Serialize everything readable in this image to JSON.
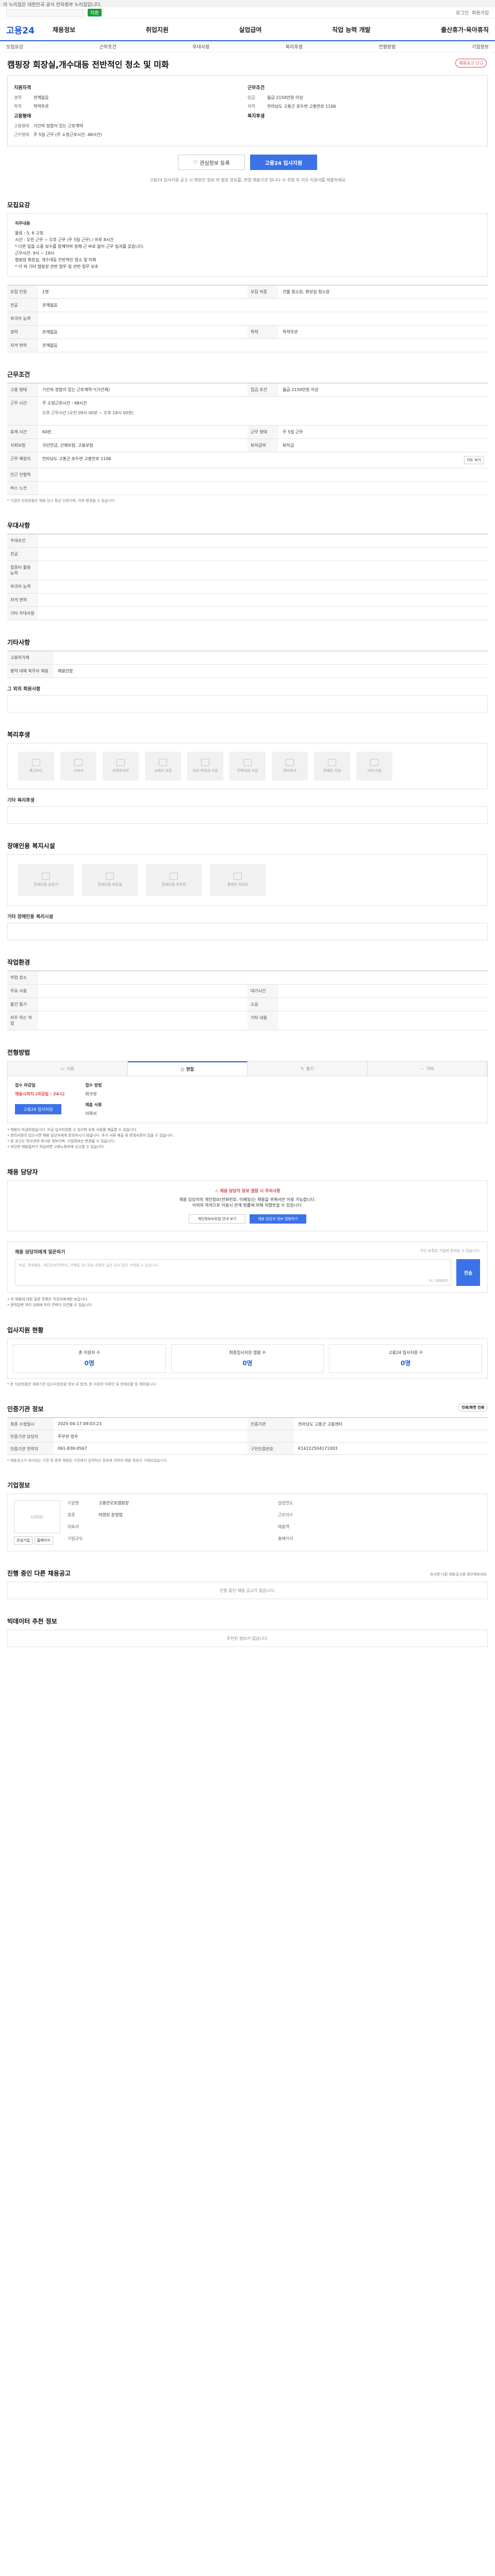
{
  "topbar": {
    "text": "이 누리집은 대한민국 공식 전자정부 누리집입니다."
  },
  "gov_banner": {
    "badge": "지원",
    "util_links": [
      "로그인",
      "회원가입"
    ]
  },
  "header": {
    "logo": "고용24",
    "nav": [
      "채용정보",
      "취업지원",
      "실업급여",
      "직업 능력 개발",
      "출산휴가·육아휴직"
    ]
  },
  "sub_tabs": [
    "모집요강",
    "근무조건",
    "우대사항",
    "복리후생",
    "전형방법",
    "기업정보"
  ],
  "page": {
    "title": "캠핑장 회장실,개수대등 전반적인 청소 및 미화",
    "report_label": "채용공고 신고"
  },
  "summary": {
    "left_heading_1": "지원자격",
    "left_items": [
      {
        "k": "경력",
        "v": "관계없음"
      },
      {
        "k": "학력",
        "v": "학력무관"
      }
    ],
    "left_heading_2": "고용형태",
    "left_items_2": [
      {
        "k": "고용형태",
        "v": "기간의 정함이 있는 근로계약"
      },
      {
        "k": "근무형태",
        "v": "주 5일 근무 (주 소정근로시간: 48시간)"
      }
    ],
    "right_heading_1": "근무조건",
    "right_items": [
      {
        "k": "임금",
        "v": "월급 2150만원 이상"
      },
      {
        "k": "지역",
        "v": "전라남도 고흥군 포두면 고흥만로 1106"
      }
    ],
    "right_heading_2": "복지후생"
  },
  "actions": {
    "bookmark": "관심정보 등록",
    "apply": "고용24 입사지원"
  },
  "notice": {
    "text": "고용24 입사지원 공고 시 회원인 정보 외 필요 정보를, 면접 채용기관 입니다 시 추첨 후 지오 지원서를 제출하세요",
    "highlight": "면접 채용기관"
  },
  "recruit": {
    "title": "모집요강",
    "duties_heading": "직무내용",
    "duties_lines": [
      "물류 : 5, 6 고정",
      "시간 : 오전 근무 ~ 오후 근무 (주 5일 근무) / 하루 8시간",
      "* 다른 일을 소중 보수를 함께하며 정해 근 바로 없이 근무 일과를 갖습니다.",
      "근무시간: 9시 ~ 18시",
      "",
      "캠핑장 회장실, 개수대등 전반적인 청소 및 미화",
      "* 이 외 기타 캠핑장 관련 업무 일 관련 업무 보조"
    ],
    "table": [
      {
        "th": "모집 인원",
        "td": "1명",
        "th2": "모집 직종",
        "td2": "건물 청소원, 화장실 청소원"
      },
      {
        "th": "전공",
        "td": "관계없음"
      },
      {
        "th": "외국어 능력",
        "td": ""
      },
      {
        "th": "경력",
        "td": "관계없음",
        "th2": "학력",
        "td2": "학력무관"
      },
      {
        "th": "자격 면허",
        "td": "관계없음"
      }
    ]
  },
  "conditions": {
    "title": "근무조건",
    "rows": [
      {
        "th": "고용 형태",
        "td": "기간의 정함이 있는 근로계약  *(기간제)",
        "th2": "임금 조건",
        "td2": "월급 2150만원 이상"
      },
      {
        "th": "근무 시간",
        "td": "주 소정근로시간 : 48시간",
        "td_sub": "오후 근무시간 (오전 09시 00분 ~ 오후 18시 00분)"
      },
      {
        "th": "휴게 시간",
        "td": "60분",
        "th2": "근무 형태",
        "td2": "주 5일 근무"
      },
      {
        "th": "사회보험",
        "td": "국민연금, 산재보험, 고용보험",
        "th2": "퇴직급여",
        "td2": "퇴직금"
      },
      {
        "th": "근무 예정지",
        "td": "전라남도 고흥군 포두면 고흥만로 1106",
        "btn": "지도 보기"
      },
      {
        "th": "인근 전철역",
        "td": ""
      },
      {
        "th": "버스 노선",
        "td": ""
      }
    ],
    "footnote": "* 기업의 인원현황은 채용 당시 평균 인원이며, 이후 변경될 수 있습니다."
  },
  "preferences": {
    "title": "우대사항",
    "rows": [
      {
        "th": "우대조건",
        "td": ""
      },
      {
        "th": "전공",
        "td": ""
      },
      {
        "th": "컴퓨터 활용 능력",
        "td": ""
      },
      {
        "th": "외국어 능력",
        "td": ""
      },
      {
        "th": "자격 면허",
        "td": ""
      },
      {
        "th": "기타 우대사항",
        "td": ""
      }
    ]
  },
  "other": {
    "title": "기타사항",
    "rows": [
      {
        "th": "고용허가제",
        "td": ""
      },
      {
        "th": "병역 대체 복무자 채용",
        "td": "채용안함"
      }
    ],
    "sub_title": "그 외의 회원사항"
  },
  "welfare": {
    "title": "복리후생",
    "items": [
      "통근버스",
      "기숙사",
      "차량유지비",
      "교육비 지원",
      "자녀 학자금 지원",
      "주택자금 지원",
      "경조휴가",
      "장애인 지원",
      "기타 지원"
    ],
    "sub_title": "기타 복리후생"
  },
  "disability": {
    "title": "장애인용 복지시설",
    "items": [
      "장애인용 승강기",
      "장애인용 화장실",
      "장애인용 주차장",
      "휠체어 리프트"
    ],
    "sub_title": "기타 장애인용 복리시설"
  },
  "env": {
    "title": "작업환경",
    "rows": [
      {
        "th": "작업 장소",
        "td": ""
      },
      {
        "th": "주요 사용",
        "td": "",
        "th2": "대기시간",
        "td2": ""
      },
      {
        "th": "물건 들기",
        "td": "",
        "th2": "소음",
        "td2": ""
      },
      {
        "th": "자주 하는 작업",
        "td": "",
        "th2": "기타 내용",
        "td2": ""
      }
    ]
  },
  "method": {
    "title": "전형방법",
    "tabs": [
      "서류",
      "면접",
      "필기",
      "기타"
    ],
    "active_index": 1,
    "receipt_label": "접수 마감일",
    "receipt_value": "채용시까지 (마감일 : 24시)",
    "method_label": "접수 방법",
    "method_value": "워크넷",
    "doc_label": "제출 서류",
    "doc_value": "이력서",
    "apply_btn": "고용24 입사지원",
    "bullets": [
      "• 채용이 마감되었습니다. 지금 입사지원할 수 있으며 요청 서류를 제출할 수 있습니다.",
      "• 문의사항이 있으시면 채용 담당자에게 문의하시기 바랍니다. 추가 서류 제출 및 변경사항이 있을 수 있습니다.",
      "• 본 공고는 워크넷에 게시된 정보이며, 기업정보는 변경될 수 있습니다.",
      "• 부당한 채용절차가 의심되면 고용노동부에 신고할 수 있습니다."
    ]
  },
  "contact": {
    "title": "채용 담당자",
    "warn": "채용 담당자 정보 열람 시 주의사항",
    "text_1": "채용 담당자의 개인정보(전화번호, 이메일)는 채용을 위해서만 이용 가능합니다.",
    "text_2": "이외의 목적으로 이용시 관계 법률에 의해 처벌받을 수 있습니다.",
    "btn_1": "개인정보보호법 안내 보기",
    "btn_2": "채용 담당자 정보 열람하기"
  },
  "question": {
    "title": "채용 담당자에게 질문하기",
    "hint": "구인 등록된 기업에 문의할 수 있습니다.",
    "placeholder": "욕설, 명예훼손, 개인정보(연락처, 이메일 등) 등을 포함한 글은 공지 없이 삭제될 수 있습니다.",
    "count": "0 / 1000자",
    "submit": "전송",
    "bullets": [
      "• 이 채용에 대한 질문 목록은 작성자에게만 보입니다.",
      "• 문의답변 처리 상태에 따라 연락이 지연될 수 있습니다."
    ]
  },
  "stats": {
    "title": "입사지원 현황",
    "cards": [
      {
        "label": "총 지원자 수",
        "value": "0명"
      },
      {
        "label": "최종입사지원 열람 수",
        "value": "0명"
      },
      {
        "label": "고용24 입사지원 수",
        "value": "0명"
      }
    ],
    "note": "* 본 지원현황은 채용기관 입사지원현황 정보 로 합계, 본 지원의 미확인 및 현재상황 등 제외됩니다."
  },
  "job_info": {
    "title": "인증기관 정보",
    "print_btn": "인쇄/화면 인쇄",
    "rows": [
      {
        "th": "최종 수정일시",
        "td": "2025-04-17 09:03:23",
        "th2": "인증기관",
        "td2": "전라남도 고흥군 고용센터"
      },
      {
        "th": "인증기관 담당자",
        "td": "주무관 정우",
        "th2": "",
        "td2": ""
      },
      {
        "th": "인증기관 연락처",
        "td": "061-830-0567",
        "th2": "구인인증번호",
        "td2": "K14222504171003"
      }
    ],
    "footnote": "* 채용공고가 게시되는 기관 및 중복 채용된 기관에서 입력하신 정보에 의하여 채용 정보가 기재되었습니다."
  },
  "company": {
    "title": "기업정보",
    "logo": "LOGO",
    "btn_1": "관심기업",
    "btn_2": "홈페이지",
    "rows": [
      {
        "k": "기업명",
        "v": "고흥만오토캠핑장"
      },
      {
        "k": "업종",
        "v": "야영장 운영업"
      },
      {
        "k": "대표자",
        "v": ""
      },
      {
        "k": "기업규모",
        "v": ""
      }
    ],
    "rows_right": [
      {
        "k": "설립연도",
        "v": ""
      },
      {
        "k": "근로자수",
        "v": ""
      },
      {
        "k": "매출액",
        "v": ""
      },
      {
        "k": "홈페이지",
        "v": ""
      }
    ]
  },
  "related": {
    "title": "진행 중인 다른 채용공고",
    "more": "유사한 다른 채용공고를 확인해보세요.",
    "empty": "진행 중인 채용 공고가 없습니다."
  },
  "recommend": {
    "title": "빅데이터 추천 정보",
    "empty": "추천된 정보가 없습니다."
  }
}
